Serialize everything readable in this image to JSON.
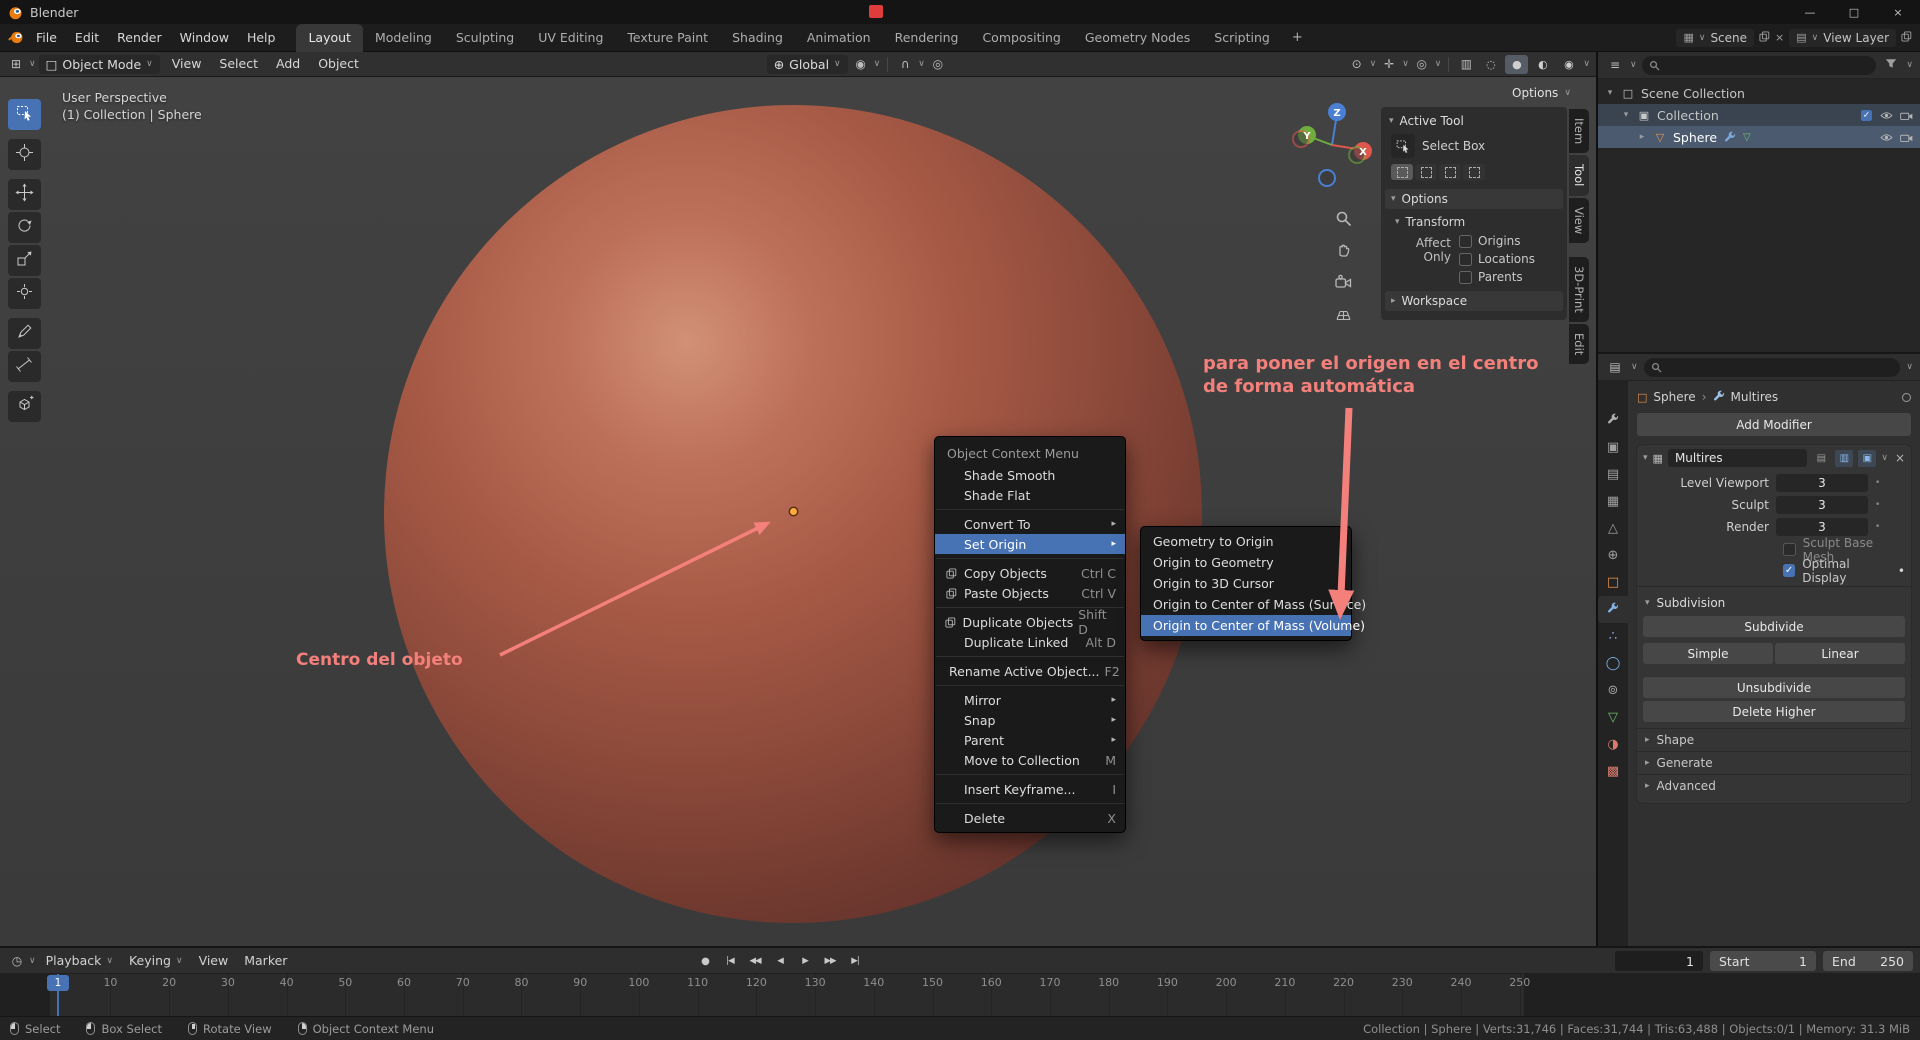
{
  "titlebar": {
    "app_name": "Blender"
  },
  "icons": {
    "dropdown": "∨",
    "caret_down": "▾",
    "caret_right": "▸",
    "submenu_arrow": "▸",
    "close": "×",
    "minimize": "—",
    "maximize": "□",
    "check": "✓",
    "dot": "•",
    "record": "●",
    "jump_start": "|◀",
    "prev_keyframe": "◀◀",
    "play_back": "◀",
    "play": "▶",
    "next_keyframe": "▶▶",
    "jump_end": "▶|",
    "editor_grid": "⊞",
    "outliner_editor": "≡",
    "properties_editor": "▤",
    "timeline_editor": "◷",
    "scene_mini": "▦",
    "view_layer_mini": "▤"
  },
  "topbar": {
    "menus": [
      "File",
      "Edit",
      "Render",
      "Window",
      "Help"
    ],
    "tabs": [
      "Layout",
      "Modeling",
      "Sculpting",
      "UV Editing",
      "Texture Paint",
      "Shading",
      "Animation",
      "Rendering",
      "Compositing",
      "Geometry Nodes",
      "Scripting"
    ],
    "active_tab": "Layout",
    "add_tab": "+",
    "scene_label": "Scene",
    "view_layer_label": "View Layer"
  },
  "viewport_header": {
    "mode_icon": "□",
    "mode_label": "Object Mode",
    "menus": [
      "View",
      "Select",
      "Add",
      "Object"
    ],
    "orientation_icon": "⊕",
    "orientation": "Global",
    "pivot_icon": "◉",
    "snap_icon": "∩",
    "proportional_icon": "◎",
    "visibility_icon": "⊙",
    "gizmos_icon": "✛",
    "overlays_icon": "◎",
    "xray_icon": "▥",
    "shading": {
      "wireframe": "◌",
      "solid": "●",
      "material": "◐",
      "rendered": "◉"
    },
    "options_label": "Options"
  },
  "viewport": {
    "overlay_line1": "User Perspective",
    "overlay_line2": "(1) Collection | Sphere",
    "axis_labels": {
      "x": "X",
      "y": "Y",
      "z": "Z"
    }
  },
  "npanel": {
    "header": "Active Tool",
    "tool_name": "Select Box",
    "options": "Options",
    "transform": "Transform",
    "affect_only": "Affect Only",
    "checkboxes": [
      "Origins",
      "Locations",
      "Parents"
    ],
    "workspace": "Workspace",
    "tabs": [
      "Item",
      "Tool",
      "View",
      "3D-Print",
      "Edit"
    ],
    "active_tab": "Tool"
  },
  "context_menu": {
    "title": "Object Context Menu",
    "items": [
      {
        "label": "Shade Smooth"
      },
      {
        "label": "Shade Flat"
      },
      {
        "sep": true
      },
      {
        "label": "Convert To",
        "submenu": true
      },
      {
        "label": "Set Origin",
        "submenu": true,
        "active": true
      },
      {
        "sep": true
      },
      {
        "label": "Copy Objects",
        "shortcut": "Ctrl C",
        "icon": "copy"
      },
      {
        "label": "Paste Objects",
        "shortcut": "Ctrl V",
        "icon": "paste"
      },
      {
        "sep": true
      },
      {
        "label": "Duplicate Objects",
        "shortcut": "Shift D",
        "icon": "duplicate"
      },
      {
        "label": "Duplicate Linked",
        "shortcut": "Alt D"
      },
      {
        "sep": true
      },
      {
        "label": "Rename Active Object...",
        "shortcut": "F2"
      },
      {
        "sep": true
      },
      {
        "label": "Mirror",
        "submenu": true
      },
      {
        "label": "Snap",
        "submenu": true
      },
      {
        "label": "Parent",
        "submenu": true
      },
      {
        "label": "Move to Collection",
        "shortcut": "M"
      },
      {
        "sep": true
      },
      {
        "label": "Insert Keyframe...",
        "shortcut": "I"
      },
      {
        "sep": true
      },
      {
        "label": "Delete",
        "shortcut": "X"
      }
    ]
  },
  "submenu": {
    "items": [
      "Geometry to Origin",
      "Origin to Geometry",
      "Origin to 3D Cursor",
      "Origin to Center of Mass (Surface)",
      "Origin to Center of Mass (Volume)"
    ],
    "active": "Origin to Center of Mass (Volume)"
  },
  "annotations": {
    "color": "#f4807c",
    "top_line1": "para poner el origen en el centro",
    "top_line2": "de forma automática",
    "center": "Centro del objeto"
  },
  "outliner": {
    "rows": [
      {
        "label": "Scene Collection",
        "depth": 0,
        "icon": "scene-collection",
        "disclosure": "down",
        "right_icons": []
      },
      {
        "label": "Collection",
        "depth": 1,
        "icon": "collection",
        "disclosure": "down",
        "state": "active",
        "right_icons": [
          "checkbox",
          "eye",
          "camera"
        ]
      },
      {
        "label": "Sphere",
        "depth": 2,
        "icon": "mesh",
        "disclosure": "right",
        "state": "selected",
        "inline_icons": [
          "modifier",
          "mesh-data"
        ],
        "right_icons": [
          "eye",
          "camera"
        ]
      }
    ]
  },
  "properties": {
    "object_icon": "□",
    "breadcrumb_object": "Sphere",
    "breadcrumb_separator": "›",
    "breadcrumb_modifier": "Multires",
    "add_modifier": "Add Modifier",
    "modifier_icon": "▦",
    "toggle_icons": {
      "edit": "▤",
      "viewport": "▥",
      "render": "▣"
    },
    "modifier": {
      "name": "Multires",
      "rows": [
        {
          "label": "Level Viewport",
          "value": "3"
        },
        {
          "label": "Sculpt",
          "value": "3"
        },
        {
          "label": "Render",
          "value": "3"
        }
      ],
      "sculpt_base_mesh": "Sculpt Base Mesh",
      "optimal_display": "Optimal Display",
      "subdivision": "Subdivision",
      "subdivide": "Subdivide",
      "simple": "Simple",
      "linear": "Linear",
      "unsubdivide": "Unsubdivide",
      "delete_higher": "Delete Higher",
      "sections": [
        "Shape",
        "Generate",
        "Advanced"
      ]
    },
    "tabs": [
      {
        "name": "tool",
        "type": "wrench",
        "color": "#b0b0b0"
      },
      {
        "name": "render",
        "glyph": "▣",
        "color": "#9f9f9f"
      },
      {
        "name": "output",
        "glyph": "▤",
        "color": "#9f9f9f"
      },
      {
        "name": "view-layer",
        "glyph": "▦",
        "color": "#9f9f9f"
      },
      {
        "name": "scene",
        "glyph": "△",
        "color": "#9f9f9f"
      },
      {
        "name": "world",
        "glyph": "⊕",
        "color": "#9f9f9f"
      },
      {
        "name": "object",
        "glyph": "□",
        "color": "#e8924a"
      },
      {
        "name": "modifiers",
        "type": "wrench",
        "color": "#85b4e8",
        "active": true
      },
      {
        "name": "particles",
        "glyph": "∴",
        "color": "#7fb3e8"
      },
      {
        "name": "physics",
        "glyph": "◯",
        "color": "#7fb3e8"
      },
      {
        "name": "constraints",
        "glyph": "⊚",
        "color": "#9f9f9f"
      },
      {
        "name": "object-data",
        "glyph": "▽",
        "color": "#6fbf6f"
      },
      {
        "name": "material",
        "glyph": "◑",
        "color": "#d97a6a"
      },
      {
        "name": "texture",
        "glyph": "▩",
        "color": "#d97a6a"
      }
    ]
  },
  "timeline": {
    "menus": [
      {
        "label": "Playback",
        "caret": true
      },
      {
        "label": "Keying",
        "caret": true
      },
      {
        "label": "View"
      },
      {
        "label": "Marker"
      }
    ],
    "current_frame": "1",
    "frame_value": "1",
    "start_label": "Start",
    "start_value": "1",
    "end_label": "End",
    "end_value": "250",
    "ticks": [
      "1",
      "10",
      "20",
      "30",
      "40",
      "50",
      "60",
      "70",
      "80",
      "90",
      "100",
      "110",
      "120",
      "130",
      "140",
      "150",
      "160",
      "170",
      "180",
      "190",
      "200",
      "210",
      "220",
      "230",
      "240",
      "250"
    ]
  },
  "statusbar": {
    "hints": [
      {
        "label": "Select",
        "button": "left"
      },
      {
        "label": "Box Select",
        "button": "left"
      },
      {
        "label": "Rotate View",
        "button": "middle"
      },
      {
        "label": "Object Context Menu",
        "button": "right"
      }
    ],
    "stats": "Collection | Sphere | Verts:31,746 | Faces:31,744 | Tris:63,488 | Objects:0/1 | Memory: 31.3 MiB"
  },
  "colors": {
    "accent": "#4772b3",
    "annotation": "#f4807c",
    "axis_x": "#e0564c",
    "axis_y": "#6fae3d",
    "axis_z": "#4a7fd4"
  }
}
